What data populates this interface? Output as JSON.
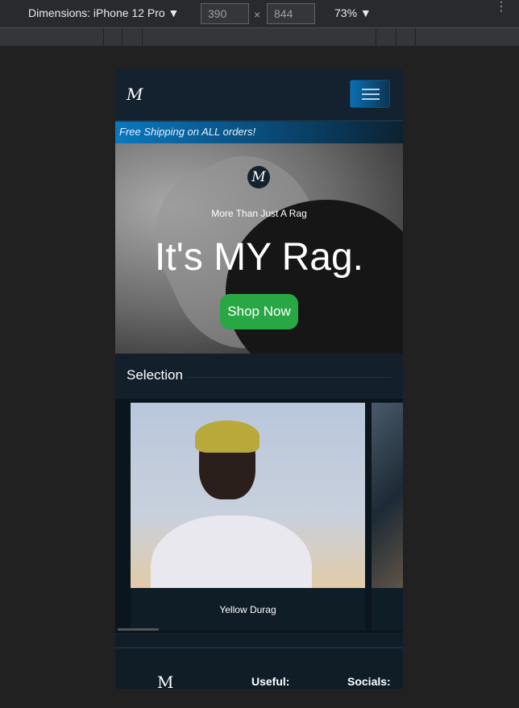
{
  "devtools": {
    "dimensions_label": "Dimensions: iPhone 12 Pro ▼",
    "width": "390",
    "height": "844",
    "times": "×",
    "zoom": "73% ▼",
    "more": "⋮"
  },
  "nav": {
    "logo": "M",
    "menu_icon": "hamburger-icon"
  },
  "banner": "Free Shipping on ALL orders!",
  "hero": {
    "mark": "M",
    "tagline": "More Than Just A Rag",
    "headline": "It's MY Rag.",
    "cta": "Shop Now"
  },
  "selection": {
    "title": "Selection",
    "items": [
      {
        "name": "Yellow Durag"
      }
    ]
  },
  "footer": {
    "logo": "M",
    "useful": "Useful:",
    "socials": "Socials:"
  }
}
